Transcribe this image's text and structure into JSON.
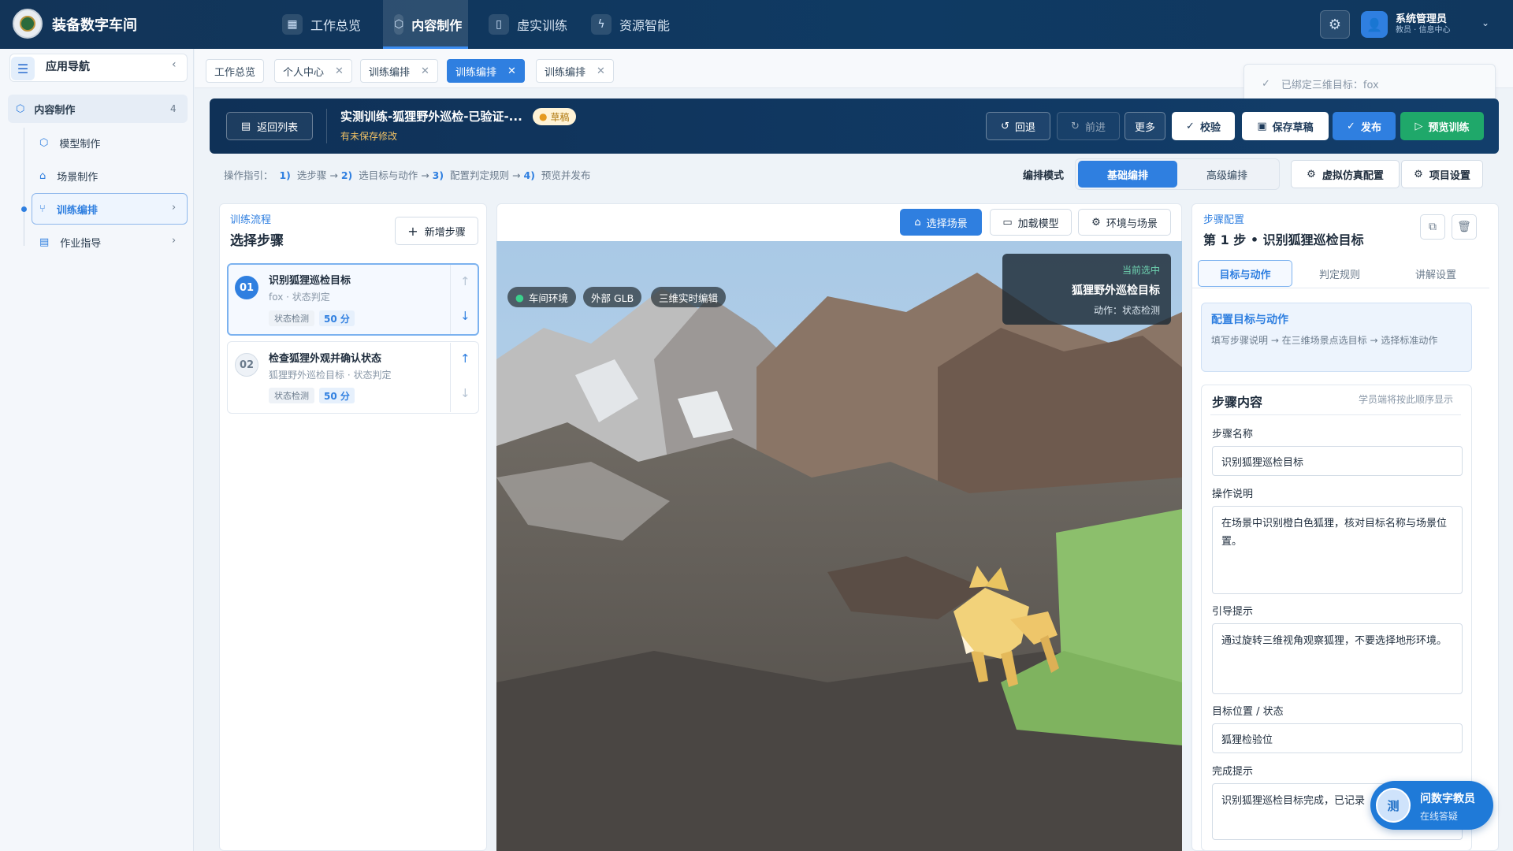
{
  "app": {
    "title": "装备数字车间"
  },
  "topnav": [
    {
      "label": "工作总览",
      "icon": "grid-icon"
    },
    {
      "label": "内容制作",
      "icon": "cube-icon"
    },
    {
      "label": "虚实训练",
      "icon": "book-icon"
    },
    {
      "label": "资源智能",
      "icon": "ai-icon"
    }
  ],
  "user": {
    "name": "系统管理员",
    "role": "教员 · 信息中心"
  },
  "sidebar": {
    "title": "应用导航",
    "group": {
      "label": "内容制作",
      "count": "4"
    },
    "items": [
      {
        "label": "模型制作",
        "icon": "cube-icon"
      },
      {
        "label": "场景制作",
        "icon": "home-icon"
      },
      {
        "label": "训练编排",
        "icon": "flow-icon"
      },
      {
        "label": "作业指导",
        "icon": "doc-icon"
      }
    ]
  },
  "tabs": [
    {
      "label": "工作总览",
      "closable": false
    },
    {
      "label": "个人中心",
      "closable": true
    },
    {
      "label": "训练编排",
      "closable": true
    },
    {
      "label": "训练编排",
      "closable": true,
      "active": true
    },
    {
      "label": "训练编排",
      "closable": true
    }
  ],
  "toast": {
    "text": "已绑定三维目标：fox"
  },
  "header": {
    "back": "返回列表",
    "title": "实测训练-狐狸野外巡检-已验证-...",
    "status": "草稿",
    "unsaved": "有未保存修改",
    "undo": "回退",
    "redo": "前进",
    "more": "更多",
    "validate": "校验",
    "save_draft": "保存草稿",
    "publish": "发布",
    "preview": "预览训练"
  },
  "guide": {
    "prefix": "操作指引：",
    "steps": [
      {
        "num": "1)",
        "label": "选步骤"
      },
      {
        "num": "2)",
        "label": "选目标与动作"
      },
      {
        "num": "3)",
        "label": "配置判定规则"
      },
      {
        "num": "4)",
        "label": "预览并发布"
      }
    ],
    "arrow": "→"
  },
  "mode": {
    "label": "编排模式",
    "basic": "基础编排",
    "advanced": "高级编排",
    "sim_config": "虚拟仿真配置",
    "project_settings": "项目设置"
  },
  "flow": {
    "label": "训练流程",
    "title": "选择步骤",
    "add": "新增步骤",
    "steps": [
      {
        "num": "01",
        "title": "识别狐狸巡检目标",
        "sub": "fox · 状态判定",
        "tag": "状态检测",
        "score": "50 分"
      },
      {
        "num": "02",
        "title": "检查狐狸外观并确认状态",
        "sub": "狐狸野外巡检目标 · 状态判定",
        "tag": "状态检测",
        "score": "50 分"
      }
    ]
  },
  "viewer": {
    "select_scene": "选择场景",
    "load_model": "加载模型",
    "env_scene": "环境与场景",
    "badges": [
      "车间环境",
      "外部 GLB",
      "三维实时编辑"
    ],
    "current": {
      "label": "当前选中",
      "name": "狐狸野外巡检目标",
      "action": "动作：状态检测"
    }
  },
  "config": {
    "label": "步骤配置",
    "title": "第 1 步 • 识别狐狸巡检目标",
    "tabs": [
      "目标与动作",
      "判定规则",
      "讲解设置"
    ],
    "box_title": "配置目标与动作",
    "box_desc": "填写步骤说明 → 在三维场景点选目标 → 选择标准动作",
    "section": "步骤内容",
    "section_hint": "学员端将按此顺序显示",
    "fields": {
      "name_label": "步骤名称",
      "name_value": "识别狐狸巡检目标",
      "desc_label": "操作说明",
      "desc_value": "在场景中识别橙白色狐狸，核对目标名称与场景位置。",
      "hint_label": "引导提示",
      "hint_value": "通过旋转三维视角观察狐狸，不要选择地形环境。",
      "pos_label": "目标位置 / 状态",
      "pos_value": "狐狸检验位",
      "done_label": "完成提示",
      "done_value": "识别狐狸巡检目标完成，已记录"
    }
  },
  "assistant": {
    "avatar": "测",
    "name": "问数字教员",
    "status": "在线答疑"
  }
}
